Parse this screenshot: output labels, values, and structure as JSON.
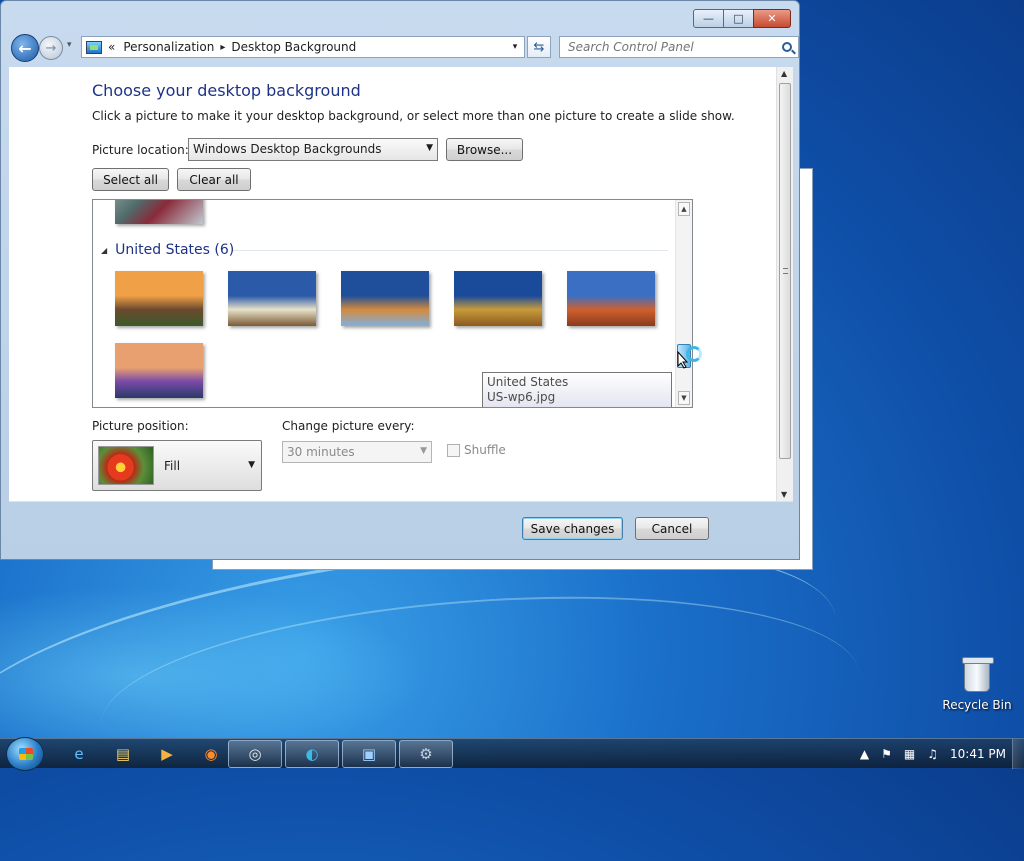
{
  "window": {
    "caption_min": "—",
    "caption_max": "□",
    "caption_close": "✕"
  },
  "nav": {
    "back_glyph": "←",
    "fwd_glyph": "→",
    "history_glyph": "▾",
    "crumb_prefix": "«",
    "crumbs": [
      "Personalization",
      "Desktop Background"
    ],
    "crumb_sep": "▸",
    "addr_dropdown": "▾",
    "refresh_glyph": "⇆",
    "search_placeholder": "Search Control Panel"
  },
  "page": {
    "title": "Choose your desktop background",
    "description": "Click a picture to make it your desktop background, or select more than one picture to create a slide show.",
    "picture_location_label": "Picture location:",
    "picture_location_value": "Windows Desktop Backgrounds",
    "browse_label": "Browse...",
    "select_all_label": "Select all",
    "clear_all_label": "Clear all"
  },
  "gallery": {
    "group_name": "United States (6)",
    "group_expander": "◢",
    "thumbnails": [
      {
        "name": "sunset-meadow",
        "colors": [
          "#f0a046",
          "#6b4a2e",
          "#3b5a2a"
        ]
      },
      {
        "name": "lighthouse",
        "colors": [
          "#2a5aa8",
          "#e8e2c8",
          "#7a5a38"
        ]
      },
      {
        "name": "sea-rock",
        "colors": [
          "#1f4f9a",
          "#d48a3c",
          "#7fb0e0"
        ]
      },
      {
        "name": "hay-bale",
        "colors": [
          "#1a4a9a",
          "#c89b3a",
          "#8a5a20"
        ]
      },
      {
        "name": "delicate-arch",
        "colors": [
          "#3a6fc4",
          "#d0602e",
          "#8a3a1e"
        ]
      },
      {
        "name": "lupine-field",
        "colors": [
          "#e8a070",
          "#7a4aa8",
          "#2a3a6a"
        ]
      }
    ],
    "tooltip_line1": "United States",
    "tooltip_line2": "US-wp6.jpg"
  },
  "options": {
    "position_label": "Picture position:",
    "position_value": "Fill",
    "change_label": "Change picture every:",
    "change_value": "30 minutes",
    "shuffle_label": "Shuffle"
  },
  "footer": {
    "save_label": "Save changes",
    "cancel_label": "Cancel"
  },
  "desktop": {
    "recycle_bin_label": "Recycle Bin"
  },
  "taskbar": {
    "items": [
      "internet-explorer-icon",
      "file-explorer-icon",
      "media-player-icon",
      "firefox-icon",
      "chrome-icon",
      "edge-icon",
      "control-panel-icon",
      "network-icon"
    ],
    "tray_expand": "▲",
    "clock": "10:41 PM"
  },
  "colors": {
    "title_blue": "#1e3287",
    "selection_border": "#3c7fb1"
  }
}
